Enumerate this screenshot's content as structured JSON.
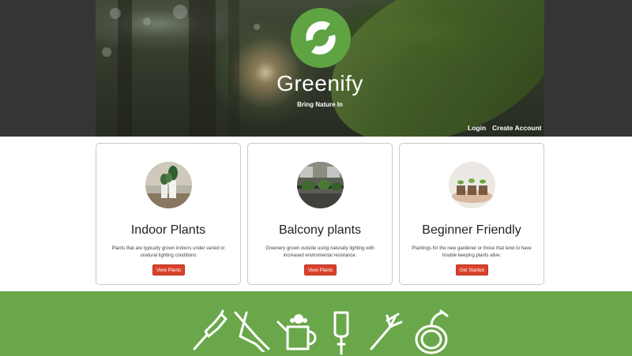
{
  "header": {
    "brand": "Greenify",
    "tagline": "Bring Nature In",
    "nav": {
      "login": "Login",
      "create_account": "Create Account"
    }
  },
  "cards": [
    {
      "title": "Indoor Plants",
      "description": "Plants that are typically grown indoors under varied or unatural lighting conditions",
      "button": "View Plants"
    },
    {
      "title": "Balcony plants",
      "description": "Greenery grown outside using naturally lighting with increased enviromental resistance.",
      "button": "View Plants"
    },
    {
      "title": "Beginner Friendly",
      "description": "Plantings for the new gardener or those that tend to have trouble keeping plants alive.",
      "button": "Get Started"
    }
  ],
  "footer": {
    "icons": [
      "shovel-icon",
      "pruning-shears-icon",
      "watering-can-icon",
      "trowel-icon",
      "garden-fork-icon",
      "garden-hose-icon"
    ]
  },
  "colors": {
    "brand_green": "#6aa74a",
    "header_dark": "#353535",
    "button_red": "#d9412c"
  }
}
